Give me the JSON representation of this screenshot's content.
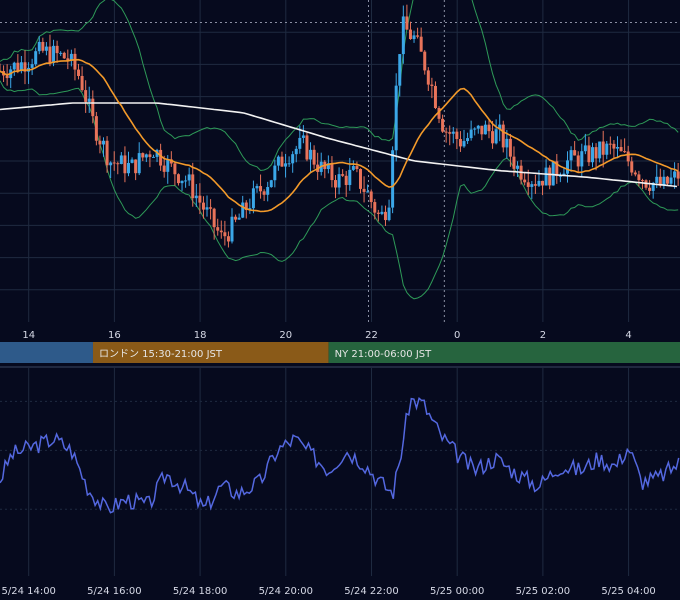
{
  "colors": {
    "background": "#060a1e",
    "grid": "#1f2a40",
    "candle_up": "#3ba7e8",
    "candle_down": "#e8735a",
    "ma_long": "#f2f2f2",
    "ma_short": "#f39a2a",
    "bollinger": "#2e9a58",
    "oscillator": "#5468e0",
    "session_tokyo": "#2e5a8a",
    "session_london": "#8a5a18",
    "session_ny": "#26643e"
  },
  "chart_data": [
    {
      "type": "candlestick",
      "x_axis": {
        "ticks": [
          {
            "t": 14,
            "label": "14"
          },
          {
            "t": 16,
            "label": "16"
          },
          {
            "t": 18,
            "label": "18"
          },
          {
            "t": 20,
            "label": "20"
          },
          {
            "t": 22,
            "label": "22"
          },
          {
            "t": 24,
            "label": "0"
          },
          {
            "t": 26,
            "label": "2"
          },
          {
            "t": 28,
            "label": "4"
          }
        ],
        "range": [
          13.33,
          29.2
        ],
        "unit": "hours (5/24 13:20 – 5/25 05:12 JST)"
      },
      "y_range": [
        0,
        100
      ],
      "grid": true,
      "reference_line": {
        "level": 93,
        "style": "dotted"
      },
      "markers": [
        {
          "t": 21.93,
          "style": "dotted"
        },
        {
          "t": 23.7,
          "style": "dotted"
        }
      ],
      "path_keypoints": [
        [
          13.33,
          78
        ],
        [
          13.8,
          80
        ],
        [
          14.3,
          84
        ],
        [
          14.9,
          82
        ],
        [
          15.2,
          76
        ],
        [
          15.5,
          62
        ],
        [
          15.9,
          50
        ],
        [
          16.4,
          48
        ],
        [
          16.9,
          54
        ],
        [
          17.3,
          48
        ],
        [
          17.7,
          44
        ],
        [
          18.1,
          35
        ],
        [
          18.5,
          26
        ],
        [
          18.8,
          30
        ],
        [
          19.2,
          38
        ],
        [
          19.6,
          44
        ],
        [
          20.0,
          52
        ],
        [
          20.4,
          55
        ],
        [
          20.8,
          48
        ],
        [
          21.2,
          44
        ],
        [
          21.6,
          46
        ],
        [
          21.9,
          40
        ],
        [
          22.2,
          32
        ],
        [
          22.4,
          37
        ],
        [
          22.55,
          68
        ],
        [
          22.7,
          92
        ],
        [
          23.0,
          88
        ],
        [
          23.3,
          78
        ],
        [
          23.7,
          60
        ],
        [
          24.1,
          56
        ],
        [
          24.6,
          60
        ],
        [
          25.0,
          58
        ],
        [
          25.4,
          48
        ],
        [
          25.8,
          44
        ],
        [
          26.2,
          46
        ],
        [
          26.6,
          50
        ],
        [
          27.1,
          52
        ],
        [
          27.6,
          54
        ],
        [
          28.0,
          50
        ],
        [
          28.4,
          44
        ],
        [
          28.8,
          42
        ],
        [
          29.2,
          46
        ]
      ]
    },
    {
      "type": "line",
      "name": "oscillator",
      "x_range": [
        13.33,
        29.2
      ],
      "y_range": [
        0,
        100
      ],
      "grid": true,
      "x_tick_labels": [
        {
          "t": 14,
          "label": "5/24 14:00"
        },
        {
          "t": 16,
          "label": "5/24 16:00"
        },
        {
          "t": 18,
          "label": "5/24 18:00"
        },
        {
          "t": 20,
          "label": "5/24 20:00"
        },
        {
          "t": 22,
          "label": "5/24 22:00"
        },
        {
          "t": 24,
          "label": "5/25 00:00"
        },
        {
          "t": 26,
          "label": "5/25 02:00"
        },
        {
          "t": 28,
          "label": "5/25 04:00"
        }
      ],
      "keypoints": [
        [
          13.33,
          45
        ],
        [
          13.6,
          58
        ],
        [
          14.1,
          62
        ],
        [
          14.6,
          66
        ],
        [
          15.0,
          60
        ],
        [
          15.4,
          40
        ],
        [
          15.8,
          30
        ],
        [
          16.3,
          35
        ],
        [
          16.8,
          32
        ],
        [
          17.2,
          48
        ],
        [
          17.7,
          40
        ],
        [
          18.1,
          30
        ],
        [
          18.5,
          42
        ],
        [
          18.9,
          38
        ],
        [
          19.4,
          44
        ],
        [
          19.8,
          60
        ],
        [
          20.2,
          66
        ],
        [
          20.6,
          58
        ],
        [
          21.0,
          50
        ],
        [
          21.4,
          60
        ],
        [
          21.8,
          54
        ],
        [
          22.2,
          44
        ],
        [
          22.5,
          38
        ],
        [
          22.7,
          60
        ],
        [
          22.9,
          86
        ],
        [
          23.2,
          84
        ],
        [
          23.6,
          68
        ],
        [
          24.0,
          58
        ],
        [
          24.4,
          50
        ],
        [
          24.9,
          56
        ],
        [
          25.4,
          48
        ],
        [
          25.9,
          42
        ],
        [
          26.4,
          52
        ],
        [
          26.9,
          50
        ],
        [
          27.3,
          56
        ],
        [
          27.7,
          52
        ],
        [
          28.0,
          62
        ],
        [
          28.3,
          44
        ],
        [
          28.7,
          46
        ],
        [
          29.2,
          54
        ]
      ]
    }
  ],
  "sessions": [
    {
      "label": "",
      "start": 13.33,
      "end": 15.5,
      "color": "#2e5a8a"
    },
    {
      "label": "ロンドン 15:30-21:00 JST",
      "start": 15.5,
      "end": 21.0,
      "color": "#8a5a18"
    },
    {
      "label": "NY 21:00-06:00 JST",
      "start": 21.0,
      "end": 29.2,
      "color": "#26643e"
    }
  ]
}
